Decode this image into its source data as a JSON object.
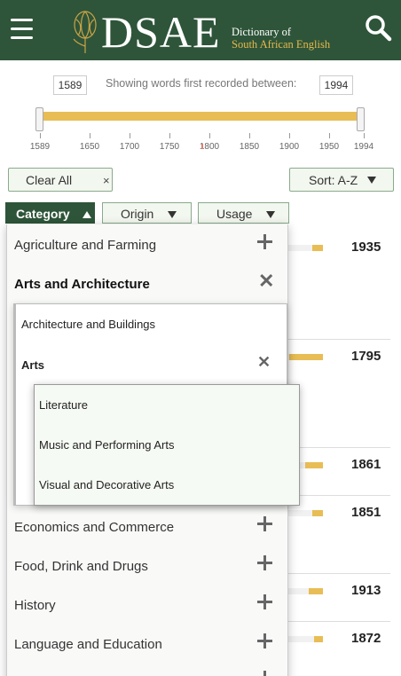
{
  "header": {
    "menu_icon": "hamburger-menu-icon",
    "logo_icon": "protea-flower-icon",
    "logo_text": "DSAE",
    "logo_sub_line1": "Dictionary of",
    "logo_sub_line2": "South African English",
    "search_icon": "search-icon",
    "bg_color": "#2e5539",
    "accent_color": "#e7b84d"
  },
  "date_range": {
    "from": "1589",
    "to": "1994",
    "caption": "Showing words first recorded between:",
    "ticks": [
      "1589",
      "1650",
      "1700",
      "1750",
      "1800",
      "1850",
      "1900",
      "1950",
      "1994"
    ]
  },
  "controls": {
    "clear_all": "Clear All",
    "clear_icon": "×",
    "sort_label": "Sort: A-Z"
  },
  "filters": {
    "category": "Category",
    "origin": "Origin",
    "usage": "Usage"
  },
  "categories": [
    {
      "label": "Agriculture and Farming"
    },
    {
      "label": "Arts and Architecture"
    },
    {
      "label": "Economics and Commerce"
    },
    {
      "label": "Food, Drink and Drugs"
    },
    {
      "label": "History"
    },
    {
      "label": "Language and Education"
    }
  ],
  "subcategories": [
    {
      "label": "Architecture and Buildings"
    },
    {
      "label": "Arts"
    }
  ],
  "subsubcategories": [
    {
      "label": "Literature"
    },
    {
      "label": "Music and Performing Arts"
    },
    {
      "label": "Visual and Decorative Arts"
    }
  ],
  "results": [
    {
      "year": "1935",
      "fill": 0.12
    },
    {
      "year": "1795",
      "fill": 0.38
    },
    {
      "year": "1861",
      "fill": 0.2
    },
    {
      "year": "1851",
      "fill": 0.12
    },
    {
      "year": "1913",
      "fill": 0.16
    },
    {
      "year": "1872",
      "fill": 0.1
    }
  ]
}
